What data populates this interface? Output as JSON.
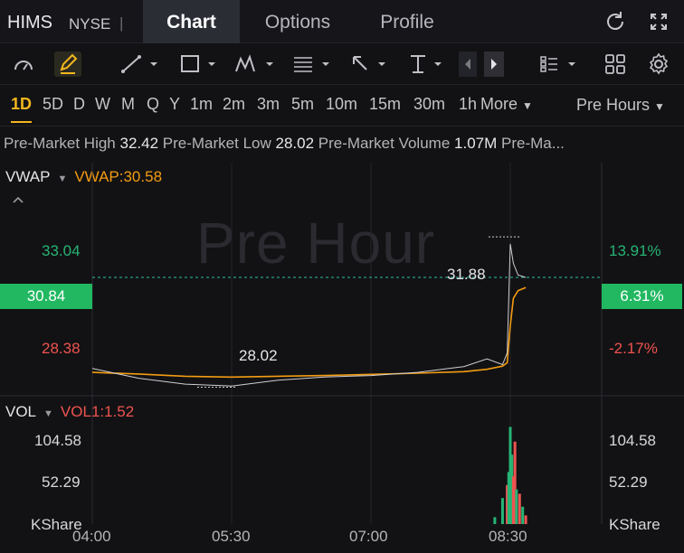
{
  "header": {
    "ticker": "HIMS",
    "exchange": "NYSE",
    "separator": "|",
    "tabs": [
      {
        "label": "Chart",
        "active": true
      },
      {
        "label": "Options",
        "active": false
      },
      {
        "label": "Profile",
        "active": false
      }
    ],
    "icons": [
      "refresh-icon",
      "fullscreen-icon"
    ]
  },
  "toolbar": {
    "icons": [
      "gauge-icon",
      "pencil-icon",
      "trend-line-icon",
      "rectangle-icon",
      "pattern-icon",
      "fib-icon",
      "arrow-icon",
      "measure-icon",
      "prev-icon",
      "next-icon",
      "list-icon",
      "grid-icon",
      "settings-icon"
    ]
  },
  "timeframes": {
    "items": [
      "1D",
      "5D",
      "D",
      "W",
      "M",
      "Q",
      "Y",
      "1m",
      "2m",
      "3m",
      "5m",
      "10m",
      "15m",
      "30m",
      "1h"
    ],
    "active": "1D",
    "more_label": "More",
    "session_label": "Pre Hours"
  },
  "info": {
    "high_label": "Pre-Market High",
    "high_value": "32.42",
    "low_label": "Pre-Market Low",
    "low_value": "28.02",
    "volume_label": "Pre-Market Volume",
    "volume_value": "1.07M",
    "truncated_label": "Pre-Ma..."
  },
  "price_panel": {
    "indicator_name": "VWAP",
    "indicator_value": "VWAP:30.58",
    "watermark": "Pre Hour",
    "left_axis": {
      "top": "33.04",
      "current": "30.84",
      "bottom": "28.38"
    },
    "right_axis": {
      "top": "13.91%",
      "current": "6.31%",
      "bottom": "-2.17%"
    },
    "high_marker": "31.88",
    "low_marker": "28.02",
    "colors": {
      "up": "#26b474",
      "down": "#ef5350",
      "vwap": "#f39c12",
      "price": "#cfcfd4",
      "tag": "#21b861"
    }
  },
  "volume_panel": {
    "indicator_name": "VOL",
    "indicator_value": "VOL1:1.52",
    "left_axis": {
      "top": "104.58",
      "mid": "52.29",
      "unit": "KShare"
    },
    "right_axis": {
      "top": "104.58",
      "mid": "52.29",
      "unit": "KShare"
    }
  },
  "time_axis": [
    "04:00",
    "05:30",
    "07:00",
    "08:30"
  ],
  "chart_data": {
    "type": "line",
    "x": [
      "04:00",
      "04:30",
      "05:00",
      "05:30",
      "06:00",
      "06:30",
      "07:00",
      "07:30",
      "08:00",
      "08:15",
      "08:25",
      "08:28",
      "08:30",
      "08:32",
      "08:35",
      "08:40"
    ],
    "series": [
      {
        "name": "VWAP",
        "values": [
          28.4,
          28.36,
          28.3,
          28.28,
          28.3,
          28.32,
          28.35,
          28.38,
          28.42,
          28.48,
          28.56,
          28.65,
          29.6,
          30.3,
          30.5,
          30.58
        ]
      },
      {
        "values": [
          28.5,
          28.25,
          28.1,
          28.05,
          28.2,
          28.28,
          28.32,
          28.4,
          28.55,
          28.75,
          28.6,
          28.9,
          31.7,
          31.2,
          30.9,
          30.84
        ]
      }
    ],
    "volume": {
      "x": [
        "08:20",
        "08:25",
        "08:28",
        "08:29",
        "08:30",
        "08:31",
        "08:32",
        "08:33",
        "08:34",
        "08:36",
        "08:38",
        "08:40"
      ],
      "values": [
        8,
        30,
        45,
        60,
        112,
        80,
        55,
        95,
        40,
        35,
        20,
        10
      ],
      "direction": [
        "up",
        "up",
        "down",
        "up",
        "up",
        "up",
        "down",
        "down",
        "up",
        "down",
        "up",
        "down"
      ]
    },
    "ylim": [
      27.8,
      33.6
    ],
    "vol_ylim": [
      0,
      125
    ]
  }
}
